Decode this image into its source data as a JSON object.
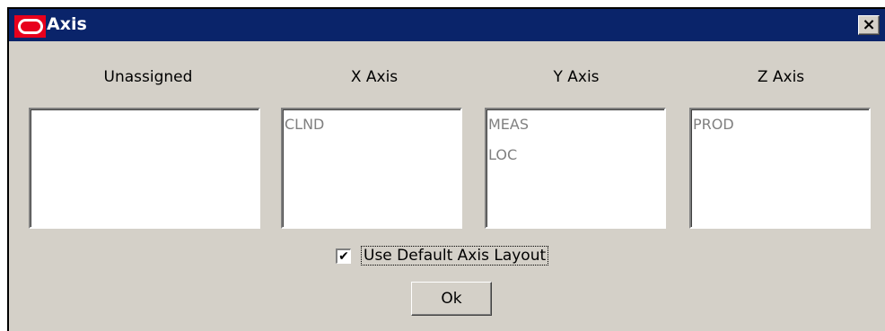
{
  "window": {
    "title": "Axis",
    "close_glyph": "×",
    "logo_icon": "oracle-logo-icon"
  },
  "axes": [
    {
      "label": "Unassigned",
      "items": []
    },
    {
      "label": "X Axis",
      "items": [
        "CLND"
      ]
    },
    {
      "label": "Y Axis",
      "items": [
        "MEAS",
        "LOC"
      ]
    },
    {
      "label": "Z Axis",
      "items": [
        "PROD"
      ]
    }
  ],
  "options": {
    "use_default_layout_label": "Use Default Axis Layout",
    "use_default_layout_checked": true,
    "check_glyph": "✔"
  },
  "buttons": {
    "ok_label": "Ok"
  },
  "colors": {
    "titlebar": "#0a246a",
    "logo": "#e8001c",
    "dialog_bg": "#d4d0c8",
    "list_text": "#808080"
  }
}
